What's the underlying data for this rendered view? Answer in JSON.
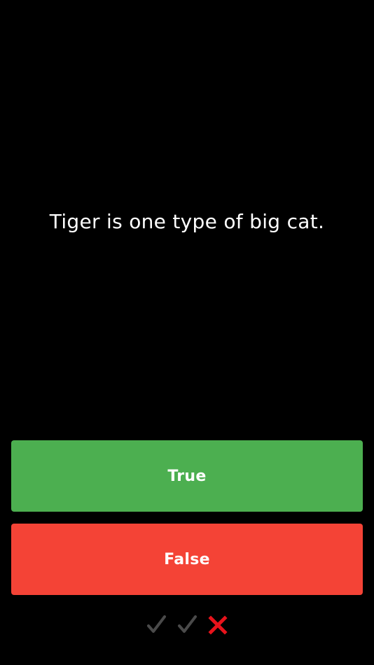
{
  "question": {
    "text": "Tiger is one type of big cat."
  },
  "answers": {
    "true_label": "True",
    "false_label": "False"
  },
  "colors": {
    "background": "#000000",
    "true_button": "#4caf50",
    "false_button": "#f44336",
    "correct_mark": "#4a4a4a",
    "wrong_mark": "#e8131b"
  },
  "score_history": [
    {
      "result": "correct",
      "icon": "checkmark-icon"
    },
    {
      "result": "correct",
      "icon": "checkmark-icon"
    },
    {
      "result": "wrong",
      "icon": "cross-icon"
    }
  ]
}
